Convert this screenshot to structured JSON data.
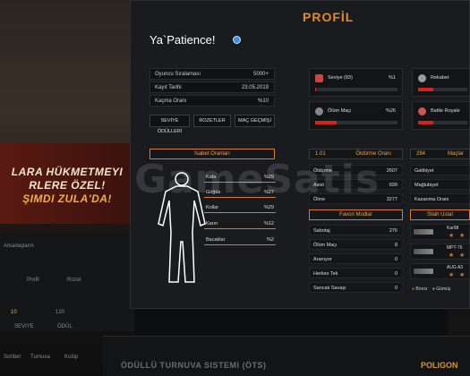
{
  "background": {
    "banner_lines": [
      "LARA HÜKMETMEYI",
      "RLERE ÖZEL!",
      "ŞIMDI ZULA'DA!"
    ],
    "left_rows": [
      "Arkadaşların",
      "Profil",
      "Rozet",
      "10",
      "120",
      "SEVIYE",
      "ÖDÜL",
      "Sohbet",
      "Turnuva",
      "Kulüp"
    ],
    "tournament_label": "ÖDÜLLÜ TURNUVA SISTEMI (ÖTS)",
    "poligon_label": "POLIGON"
  },
  "watermark": "GameSatis",
  "profile": {
    "title": "PROFİL",
    "username": "Ya`Patience!",
    "info": [
      {
        "key": "Oyuncu Sıralaması",
        "value": "5000+"
      },
      {
        "key": "Kayıt Tarihi",
        "value": "23.05.2019"
      },
      {
        "key": "Kaçma Oranı",
        "value": "%10"
      }
    ],
    "buttons": [
      "SEVİYE ÖDÜLLERİ",
      "ROZETLER",
      "MAÇ GEÇMİŞİ"
    ],
    "stat_cards": [
      {
        "label": "Seviye (83)",
        "value": "%1",
        "fill": 0.01
      },
      {
        "label": "Rekabet",
        "value": "",
        "fill": 0.3
      },
      {
        "label": "Ölüm Maçı",
        "value": "%26",
        "fill": 0.26
      },
      {
        "label": "Battle Royale",
        "value": "",
        "fill": 0.3
      }
    ],
    "isabet": {
      "title": "İsabet Oranları",
      "rows": [
        {
          "key": "Kafa",
          "value": "%29"
        },
        {
          "key": "Göğüs",
          "value": "%27"
        },
        {
          "key": "Kollar",
          "value": "%29"
        },
        {
          "key": "Karın",
          "value": "%12"
        },
        {
          "key": "Bacaklar",
          "value": "%2"
        }
      ]
    },
    "kills": {
      "number": "1.01",
      "title": "Öldürme Oranı",
      "rows": [
        {
          "key": "Öldürme",
          "value": "2607"
        },
        {
          "key": "Asist",
          "value": "699"
        },
        {
          "key": "Ölme",
          "value": "3277"
        }
      ]
    },
    "matches": {
      "number": "284",
      "title": "Maçlar",
      "rows": [
        {
          "key": "Galibiyet",
          "value": ""
        },
        {
          "key": "Mağlubiyet",
          "value": ""
        },
        {
          "key": "Kazanma Oranı",
          "value": ""
        }
      ]
    },
    "modes": {
      "title": "Favori Modlar",
      "rows": [
        {
          "key": "Sabotaj",
          "value": "276"
        },
        {
          "key": "Ölüm Maçı",
          "value": "8"
        },
        {
          "key": "Aranıyor",
          "value": "0"
        },
        {
          "key": "Herkes Tek",
          "value": "0"
        },
        {
          "key": "Sancak Savaşı",
          "value": "0"
        }
      ]
    },
    "weapons": {
      "title": "Silah Ustal",
      "items": [
        {
          "name": "Kar98"
        },
        {
          "name": "MPT-76"
        },
        {
          "name": "AUG A3"
        }
      ],
      "legend_bronz": "Bronz",
      "legend_gumus": "Gümüş"
    }
  }
}
